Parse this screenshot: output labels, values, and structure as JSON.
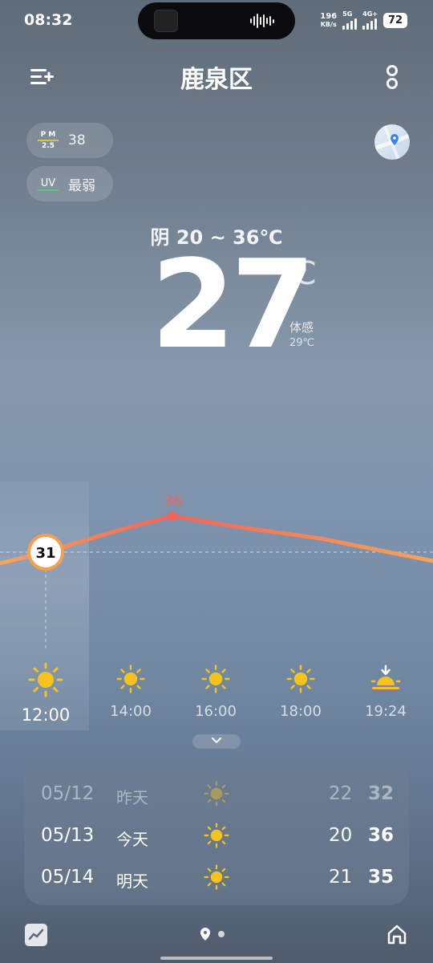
{
  "status_bar": {
    "time": "08:32",
    "net_speed_value": "196",
    "net_speed_unit": "KB/s",
    "sim1_label": "5G",
    "sim2_label": "4G+",
    "battery": "72"
  },
  "header": {
    "title": "鹿泉区",
    "menu_icon": "list-add-icon",
    "more_icon": "more-vertical-icon"
  },
  "chips": {
    "pm_label_top": "P M",
    "pm_label_bottom": "2.5",
    "pm_value": "38",
    "uv_label": "UV",
    "uv_value": "最弱"
  },
  "current": {
    "condition_range": "阴  20 ~ 36℃",
    "temp": "27",
    "unit": "℃",
    "feels_label": "体感",
    "feels_value": "29℃"
  },
  "hourly": {
    "current_temp": "31",
    "max_temp": "36",
    "items": [
      {
        "time": "12:00",
        "icon": "sun-icon"
      },
      {
        "time": "14:00",
        "icon": "sun-icon"
      },
      {
        "time": "16:00",
        "icon": "sun-icon"
      },
      {
        "time": "18:00",
        "icon": "sun-icon"
      },
      {
        "time": "19:24",
        "icon": "sunset-icon"
      }
    ],
    "expand_icon": "chevron-down-icon"
  },
  "daily": [
    {
      "date": "05/12",
      "name": "昨天",
      "icon": "sun-icon",
      "low": "22",
      "high": "32"
    },
    {
      "date": "05/13",
      "name": "今天",
      "icon": "sun-icon",
      "low": "20",
      "high": "36"
    },
    {
      "date": "05/14",
      "name": "明天",
      "icon": "sun-icon",
      "low": "21",
      "high": "35"
    }
  ],
  "colors": {
    "sun": "#f7c21c",
    "curve_start": "#f5a55a",
    "curve_peak": "#f2645a",
    "pm_accent": "#d8c24c",
    "uv_accent": "#4fd37a"
  }
}
